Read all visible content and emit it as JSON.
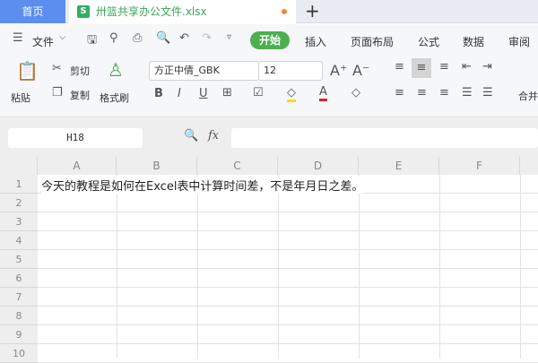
{
  "tabs": {
    "home": "首页",
    "file": "卅篮共享办公文件.xlsx",
    "new_tab": "+",
    "file_icon": "S"
  },
  "menu": {
    "file": "文件",
    "start": "开始",
    "items": [
      "插入",
      "页面布局",
      "公式",
      "数据",
      "审阅"
    ]
  },
  "ribbon": {
    "paste": "粘贴",
    "cut": "剪切",
    "copy": "复制",
    "format_painter": "格式刷",
    "font": "方正中倩_GBK",
    "size": "12",
    "merge": "合并"
  },
  "formula_bar": {
    "name_box": "H18",
    "fx": "fx",
    "value": ""
  },
  "sheet": {
    "columns": [
      "A",
      "B",
      "C",
      "D",
      "E",
      "F"
    ],
    "rows": [
      "1",
      "2",
      "3",
      "4",
      "5",
      "6",
      "7",
      "8",
      "9",
      "10"
    ],
    "A1": "今天的教程是如何在Excel表中计算时间差，不是年月日之差。"
  },
  "colors": {
    "accent": "#4caf50",
    "home_tab": "#5c8ef0"
  }
}
